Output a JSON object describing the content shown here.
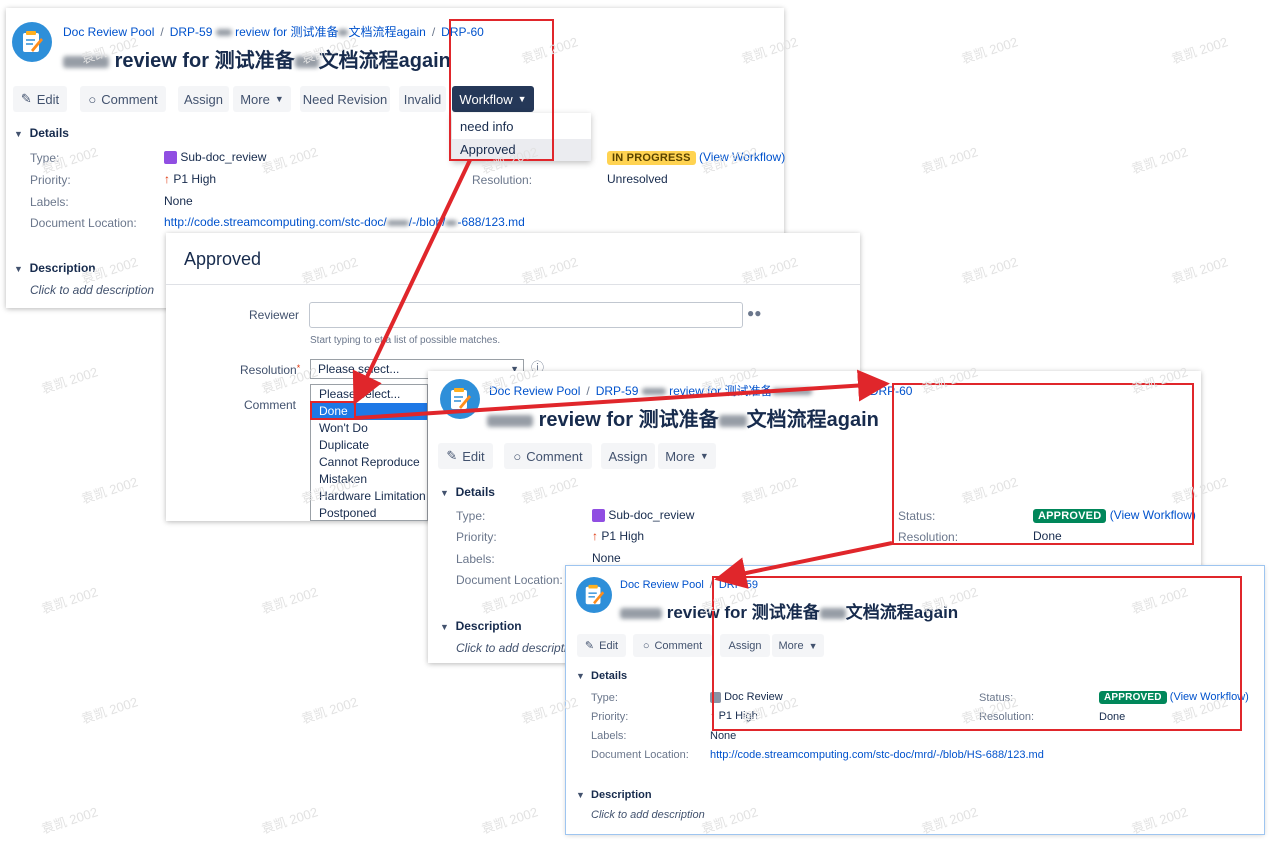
{
  "watermark_text": "袁凯 2002",
  "colors": {
    "link": "#0052cc",
    "annotation_red": "#e0262b",
    "status_in_progress": "#ffd351",
    "status_approved": "#00875a",
    "workflow_button": "#253858"
  },
  "screen1": {
    "breadcrumb": {
      "project": "Doc Review Pool",
      "parent_prefix": "DRP-59",
      "parent_suffix": "review for 测试准备",
      "parent_suffix2": "文档流程again",
      "issue": "DRP-60"
    },
    "title_main": "review for 测试准备",
    "title_end": "文档流程again",
    "toolbar": {
      "edit": "Edit",
      "comment": "Comment",
      "assign": "Assign",
      "more": "More",
      "need_revision": "Need Revision",
      "invalid": "Invalid",
      "workflow": "Workflow"
    },
    "workflow_menu": [
      "need info",
      "Approved"
    ],
    "details_heading": "Details",
    "fields": {
      "type_label": "Type:",
      "type_value": "Sub-doc_review",
      "priority_label": "Priority:",
      "priority_value": "P1 High",
      "labels_label": "Labels:",
      "labels_value": "None",
      "docloc_label": "Document Location:",
      "docloc_value": "http://code.streamcomputing.com/stc-doc/",
      "docloc_value2": "/-/blob/",
      "docloc_value3": "-688/123.md",
      "status_value": "IN PROGRESS",
      "view_workflow": "(View Workflow)",
      "resolution_label": "Resolution:",
      "resolution_value": "Unresolved"
    },
    "description_heading": "Description",
    "description_placeholder": "Click to add description"
  },
  "dialog": {
    "title": "Approved",
    "reviewer_label": "Reviewer",
    "reviewer_hint_a": "Start typing to",
    "reviewer_hint_b": "et a list of possible matches.",
    "resolution_label": "Resolution",
    "select_value": "Please select...",
    "comment_label": "Comment",
    "options": [
      "Please select...",
      "Done",
      "Won't Do",
      "Duplicate",
      "Cannot Reproduce",
      "Mistaken",
      "Hardware Limitation",
      "Postponed"
    ],
    "selected_option": "Done"
  },
  "screen2": {
    "breadcrumb": {
      "project": "Doc Review Pool",
      "parent_prefix": "DRP-59",
      "parent_suffix": "review for 测试准备",
      "issue": "DRP-60"
    },
    "title_main": "review for 测试准备",
    "title_end": "文档流程again",
    "toolbar": {
      "edit": "Edit",
      "comment": "Comment",
      "assign": "Assign",
      "more": "More"
    },
    "details_heading": "Details",
    "fields": {
      "type_label": "Type:",
      "type_value": "Sub-doc_review",
      "priority_label": "Priority:",
      "priority_value": "P1 High",
      "labels_label": "Labels:",
      "labels_value": "None",
      "docloc_label": "Document Location:",
      "status_label": "Status:",
      "status_value": "APPROVED",
      "view_workflow": "(View Workflow)",
      "resolution_label": "Resolution:",
      "resolution_value": "Done"
    },
    "description_heading": "Description",
    "description_placeholder": "Click to add descriptio"
  },
  "screen3": {
    "breadcrumb": {
      "project": "Doc Review Pool",
      "issue": "DRP-59"
    },
    "title_main": "review for 测试准备",
    "title_end": "文档流程again",
    "toolbar": {
      "edit": "Edit",
      "comment": "Comment",
      "assign": "Assign",
      "more": "More"
    },
    "details_heading": "Details",
    "fields": {
      "type_label": "Type:",
      "type_value": "Doc Review",
      "priority_label": "Priority:",
      "priority_value": "P1 High",
      "labels_label": "Labels:",
      "labels_value": "None",
      "docloc_label": "Document Location:",
      "docloc_value": "http://code.streamcomputing.com/stc-doc/mrd/-/blob/HS-688/123.md",
      "status_label": "Status:",
      "status_value": "APPROVED",
      "view_workflow": "(View Workflow)",
      "resolution_label": "Resolution:",
      "resolution_value": "Done"
    },
    "description_heading": "Description",
    "description_placeholder": "Click to add description"
  }
}
